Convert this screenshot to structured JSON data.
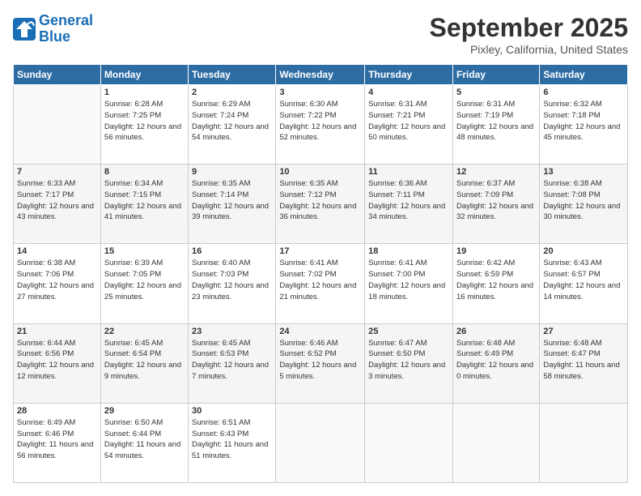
{
  "logo": {
    "line1": "General",
    "line2": "Blue"
  },
  "title": "September 2025",
  "subtitle": "Pixley, California, United States",
  "weekdays": [
    "Sunday",
    "Monday",
    "Tuesday",
    "Wednesday",
    "Thursday",
    "Friday",
    "Saturday"
  ],
  "weeks": [
    [
      {
        "day": "",
        "sunrise": "",
        "sunset": "",
        "daylight": ""
      },
      {
        "day": "1",
        "sunrise": "Sunrise: 6:28 AM",
        "sunset": "Sunset: 7:25 PM",
        "daylight": "Daylight: 12 hours and 56 minutes."
      },
      {
        "day": "2",
        "sunrise": "Sunrise: 6:29 AM",
        "sunset": "Sunset: 7:24 PM",
        "daylight": "Daylight: 12 hours and 54 minutes."
      },
      {
        "day": "3",
        "sunrise": "Sunrise: 6:30 AM",
        "sunset": "Sunset: 7:22 PM",
        "daylight": "Daylight: 12 hours and 52 minutes."
      },
      {
        "day": "4",
        "sunrise": "Sunrise: 6:31 AM",
        "sunset": "Sunset: 7:21 PM",
        "daylight": "Daylight: 12 hours and 50 minutes."
      },
      {
        "day": "5",
        "sunrise": "Sunrise: 6:31 AM",
        "sunset": "Sunset: 7:19 PM",
        "daylight": "Daylight: 12 hours and 48 minutes."
      },
      {
        "day": "6",
        "sunrise": "Sunrise: 6:32 AM",
        "sunset": "Sunset: 7:18 PM",
        "daylight": "Daylight: 12 hours and 45 minutes."
      }
    ],
    [
      {
        "day": "7",
        "sunrise": "Sunrise: 6:33 AM",
        "sunset": "Sunset: 7:17 PM",
        "daylight": "Daylight: 12 hours and 43 minutes."
      },
      {
        "day": "8",
        "sunrise": "Sunrise: 6:34 AM",
        "sunset": "Sunset: 7:15 PM",
        "daylight": "Daylight: 12 hours and 41 minutes."
      },
      {
        "day": "9",
        "sunrise": "Sunrise: 6:35 AM",
        "sunset": "Sunset: 7:14 PM",
        "daylight": "Daylight: 12 hours and 39 minutes."
      },
      {
        "day": "10",
        "sunrise": "Sunrise: 6:35 AM",
        "sunset": "Sunset: 7:12 PM",
        "daylight": "Daylight: 12 hours and 36 minutes."
      },
      {
        "day": "11",
        "sunrise": "Sunrise: 6:36 AM",
        "sunset": "Sunset: 7:11 PM",
        "daylight": "Daylight: 12 hours and 34 minutes."
      },
      {
        "day": "12",
        "sunrise": "Sunrise: 6:37 AM",
        "sunset": "Sunset: 7:09 PM",
        "daylight": "Daylight: 12 hours and 32 minutes."
      },
      {
        "day": "13",
        "sunrise": "Sunrise: 6:38 AM",
        "sunset": "Sunset: 7:08 PM",
        "daylight": "Daylight: 12 hours and 30 minutes."
      }
    ],
    [
      {
        "day": "14",
        "sunrise": "Sunrise: 6:38 AM",
        "sunset": "Sunset: 7:06 PM",
        "daylight": "Daylight: 12 hours and 27 minutes."
      },
      {
        "day": "15",
        "sunrise": "Sunrise: 6:39 AM",
        "sunset": "Sunset: 7:05 PM",
        "daylight": "Daylight: 12 hours and 25 minutes."
      },
      {
        "day": "16",
        "sunrise": "Sunrise: 6:40 AM",
        "sunset": "Sunset: 7:03 PM",
        "daylight": "Daylight: 12 hours and 23 minutes."
      },
      {
        "day": "17",
        "sunrise": "Sunrise: 6:41 AM",
        "sunset": "Sunset: 7:02 PM",
        "daylight": "Daylight: 12 hours and 21 minutes."
      },
      {
        "day": "18",
        "sunrise": "Sunrise: 6:41 AM",
        "sunset": "Sunset: 7:00 PM",
        "daylight": "Daylight: 12 hours and 18 minutes."
      },
      {
        "day": "19",
        "sunrise": "Sunrise: 6:42 AM",
        "sunset": "Sunset: 6:59 PM",
        "daylight": "Daylight: 12 hours and 16 minutes."
      },
      {
        "day": "20",
        "sunrise": "Sunrise: 6:43 AM",
        "sunset": "Sunset: 6:57 PM",
        "daylight": "Daylight: 12 hours and 14 minutes."
      }
    ],
    [
      {
        "day": "21",
        "sunrise": "Sunrise: 6:44 AM",
        "sunset": "Sunset: 6:56 PM",
        "daylight": "Daylight: 12 hours and 12 minutes."
      },
      {
        "day": "22",
        "sunrise": "Sunrise: 6:45 AM",
        "sunset": "Sunset: 6:54 PM",
        "daylight": "Daylight: 12 hours and 9 minutes."
      },
      {
        "day": "23",
        "sunrise": "Sunrise: 6:45 AM",
        "sunset": "Sunset: 6:53 PM",
        "daylight": "Daylight: 12 hours and 7 minutes."
      },
      {
        "day": "24",
        "sunrise": "Sunrise: 6:46 AM",
        "sunset": "Sunset: 6:52 PM",
        "daylight": "Daylight: 12 hours and 5 minutes."
      },
      {
        "day": "25",
        "sunrise": "Sunrise: 6:47 AM",
        "sunset": "Sunset: 6:50 PM",
        "daylight": "Daylight: 12 hours and 3 minutes."
      },
      {
        "day": "26",
        "sunrise": "Sunrise: 6:48 AM",
        "sunset": "Sunset: 6:49 PM",
        "daylight": "Daylight: 12 hours and 0 minutes."
      },
      {
        "day": "27",
        "sunrise": "Sunrise: 6:48 AM",
        "sunset": "Sunset: 6:47 PM",
        "daylight": "Daylight: 11 hours and 58 minutes."
      }
    ],
    [
      {
        "day": "28",
        "sunrise": "Sunrise: 6:49 AM",
        "sunset": "Sunset: 6:46 PM",
        "daylight": "Daylight: 11 hours and 56 minutes."
      },
      {
        "day": "29",
        "sunrise": "Sunrise: 6:50 AM",
        "sunset": "Sunset: 6:44 PM",
        "daylight": "Daylight: 11 hours and 54 minutes."
      },
      {
        "day": "30",
        "sunrise": "Sunrise: 6:51 AM",
        "sunset": "Sunset: 6:43 PM",
        "daylight": "Daylight: 11 hours and 51 minutes."
      },
      {
        "day": "",
        "sunrise": "",
        "sunset": "",
        "daylight": ""
      },
      {
        "day": "",
        "sunrise": "",
        "sunset": "",
        "daylight": ""
      },
      {
        "day": "",
        "sunrise": "",
        "sunset": "",
        "daylight": ""
      },
      {
        "day": "",
        "sunrise": "",
        "sunset": "",
        "daylight": ""
      }
    ]
  ]
}
